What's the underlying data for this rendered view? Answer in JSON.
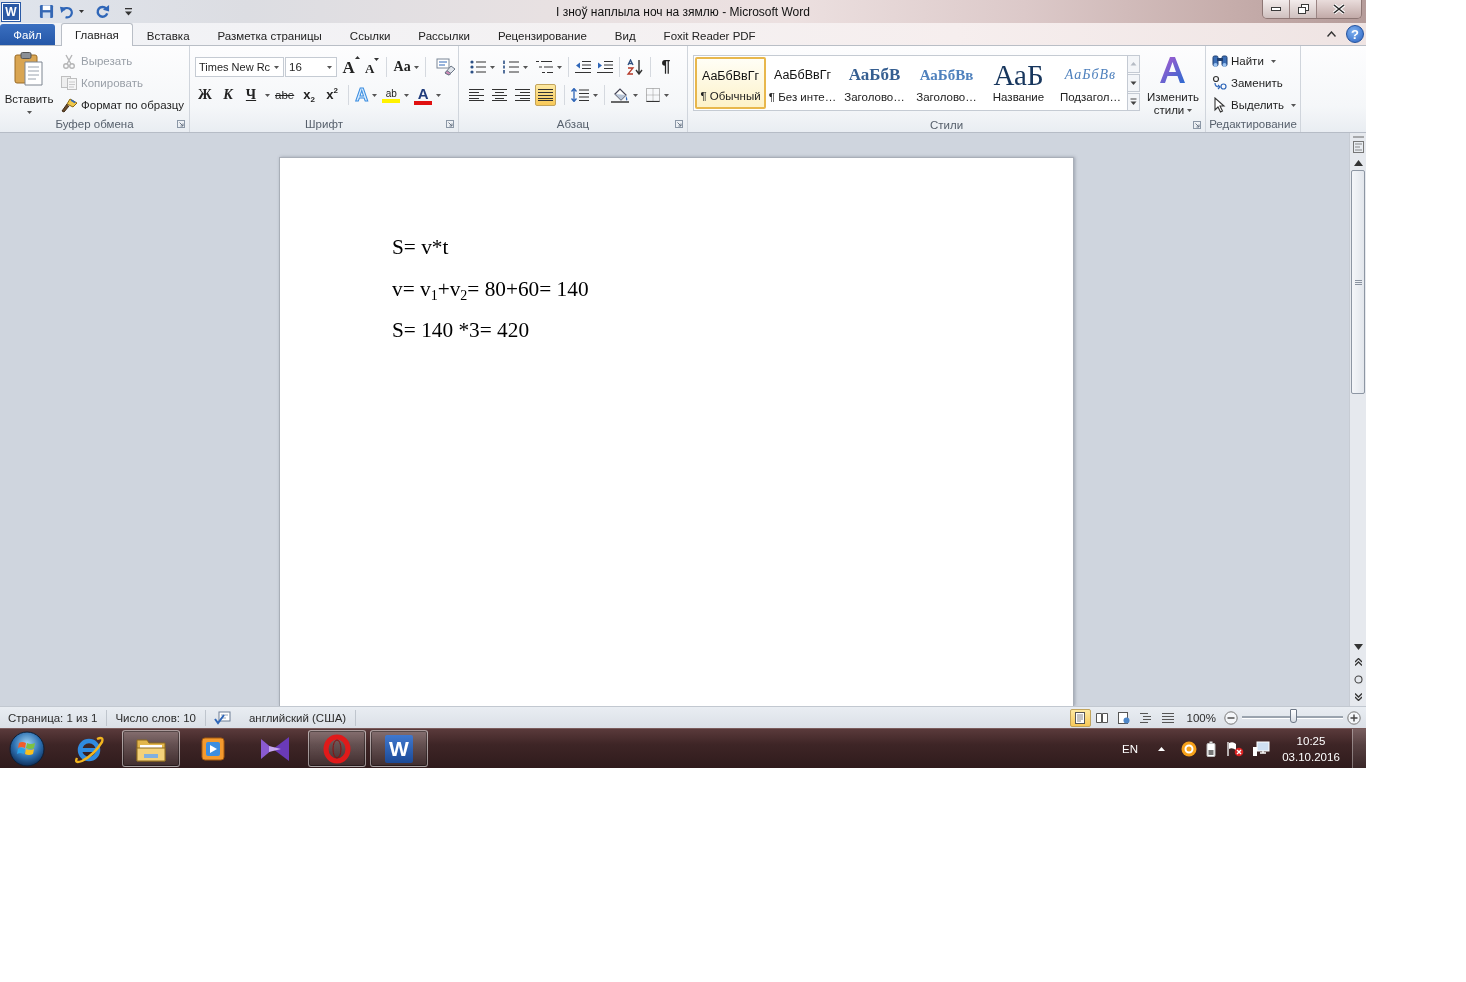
{
  "title_bar": {
    "logo": "W",
    "title": "І зноў наплыла ноч на зямлю - Microsoft Word"
  },
  "tabs": [
    {
      "kind": "file",
      "label": "Файл",
      "selected": false
    },
    {
      "kind": "tab",
      "label": "Главная",
      "selected": true
    },
    {
      "kind": "tab",
      "label": "Вставка",
      "selected": false
    },
    {
      "kind": "tab",
      "label": "Разметка страницы",
      "selected": false
    },
    {
      "kind": "tab",
      "label": "Ссылки",
      "selected": false
    },
    {
      "kind": "tab",
      "label": "Рассылки",
      "selected": false
    },
    {
      "kind": "tab",
      "label": "Рецензирование",
      "selected": false
    },
    {
      "kind": "tab",
      "label": "Вид",
      "selected": false
    },
    {
      "kind": "tab",
      "label": "Foxit Reader PDF",
      "selected": false
    }
  ],
  "ribbon_help": "?",
  "clipboard": {
    "label": "Буфер обмена",
    "paste": "Вставить",
    "items": [
      {
        "kind": "cut",
        "label": "Вырезать",
        "disabled": true
      },
      {
        "kind": "copy",
        "label": "Копировать",
        "disabled": true
      },
      {
        "kind": "format_painter",
        "label": "Формат по образцу",
        "disabled": false
      }
    ]
  },
  "font": {
    "label": "Шрифт",
    "font_name": "Times New Rc",
    "font_size": "16",
    "size_buttons": [
      {
        "kind": "grow",
        "label": "A"
      },
      {
        "kind": "shrink",
        "label": "A"
      }
    ],
    "case_button": "Aa",
    "format_buttons": [
      {
        "kind": "bold",
        "label": "Ж",
        "menu": false
      },
      {
        "kind": "italic",
        "label": "К",
        "menu": false
      },
      {
        "kind": "underline",
        "label": "Ч",
        "menu": true
      },
      {
        "kind": "strike",
        "label": "abe",
        "menu": false
      },
      {
        "kind": "subscript",
        "label": "x$_{2}$",
        "menu": false
      },
      {
        "kind": "superscript",
        "label": "x$^{2}$",
        "menu": false
      }
    ],
    "color_buttons": [
      {
        "kind": "effects",
        "label": "A",
        "menu": true
      },
      {
        "kind": "highlight",
        "label": "ab",
        "menu": true
      },
      {
        "kind": "font_color",
        "label": "A",
        "menu": true
      }
    ]
  },
  "paragraph": {
    "label": "Абзац",
    "marks_button": "¶",
    "alignment": [
      {
        "kind": "left",
        "selected": false
      },
      {
        "kind": "center",
        "selected": false
      },
      {
        "kind": "right",
        "selected": false
      },
      {
        "kind": "justify",
        "selected": true
      }
    ]
  },
  "styles": {
    "label": "Стили",
    "items": [
      {
        "kind": "normal",
        "sample": "АаБбВвГг",
        "name": "¶ Обычный",
        "selected": true
      },
      {
        "kind": "normal",
        "sample": "АаБбВвГг",
        "name": "¶ Без инте…",
        "selected": false
      },
      {
        "kind": "heading1",
        "sample": "АаБбВ",
        "name": "Заголово…",
        "selected": false
      },
      {
        "kind": "heading2",
        "sample": "АаБбВв",
        "name": "Заголово…",
        "selected": false
      },
      {
        "kind": "title",
        "sample": "АаБ",
        "name": "Название",
        "selected": false
      },
      {
        "kind": "subtitle",
        "sample": "АаБбВв",
        "name": "Подзагол…",
        "selected": false
      }
    ],
    "change_styles": "Изменить стили"
  },
  "editing": {
    "label": "Редактирование",
    "items": [
      {
        "kind": "find",
        "label": "Найти",
        "menu": true
      },
      {
        "kind": "replace",
        "label": "Заменить",
        "menu": false
      },
      {
        "kind": "select",
        "label": "Выделить",
        "menu": true
      }
    ]
  },
  "document": {
    "paragraphs": [
      "S= v*t",
      "v= v$_{1}$+v$_{2}$= 80+60= 140",
      "S= 140 *3= 420"
    ]
  },
  "status_bar": {
    "page": "Страница: 1 из 1",
    "words": "Число слов: 10",
    "language": "английский (США)",
    "views": [
      {
        "kind": "print_layout",
        "selected": true
      },
      {
        "kind": "full_screen",
        "selected": false
      },
      {
        "kind": "web",
        "selected": false
      },
      {
        "kind": "outline",
        "selected": false
      },
      {
        "kind": "draft",
        "selected": false
      }
    ],
    "zoom": {
      "reading": "100%",
      "level": 0.5
    }
  },
  "taskbar": {
    "apps": [
      {
        "kind": "browser",
        "open": false
      },
      {
        "kind": "folder",
        "open": true
      },
      {
        "kind": "player",
        "open": false
      },
      {
        "kind": "bowtie",
        "open": false
      },
      {
        "kind": "ring",
        "open": true
      },
      {
        "kind": "word",
        "logo": "W",
        "open": true
      }
    ],
    "language": "EN",
    "time": "10:25",
    "date": "03.10.2016"
  }
}
